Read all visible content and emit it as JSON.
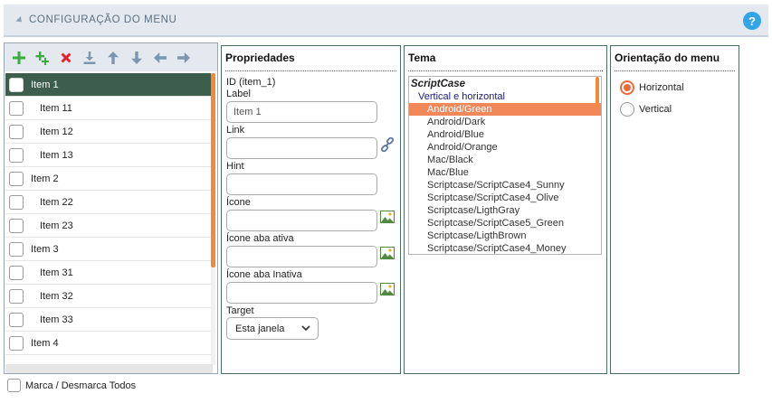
{
  "header": {
    "title": "CONFIGURAÇÃO DO MENU",
    "help_glyph": "?"
  },
  "toolbar": {
    "icons": [
      "add-icon",
      "add-child-icon",
      "delete-icon",
      "download-icon",
      "arrow-up-icon",
      "arrow-down-icon",
      "arrow-left-icon",
      "arrow-right-icon"
    ],
    "colors": {
      "add": "#3dab3d",
      "delete": "#e3232f",
      "move": "#7d96b0"
    }
  },
  "items": [
    {
      "label": "Item 1",
      "level": 0,
      "selected": true
    },
    {
      "label": "Item 11",
      "level": 1
    },
    {
      "label": "Item 12",
      "level": 1
    },
    {
      "label": "Item 13",
      "level": 1
    },
    {
      "label": "Item 2",
      "level": 0
    },
    {
      "label": "Item 22",
      "level": 1
    },
    {
      "label": "Item 23",
      "level": 1
    },
    {
      "label": "Item 3",
      "level": 0
    },
    {
      "label": "Item 31",
      "level": 1
    },
    {
      "label": "Item 32",
      "level": 1
    },
    {
      "label": "Item 33",
      "level": 1
    },
    {
      "label": "Item 4",
      "level": 0
    }
  ],
  "properties": {
    "title": "Propriedades",
    "id_text": "ID (item_1)",
    "label_caption": "Label",
    "label_value": "Item 1",
    "link_caption": "Link",
    "link_value": "",
    "hint_caption": "Hint",
    "hint_value": "",
    "icone_caption": "Ícone",
    "icone_value": "",
    "icone_ativa_caption": "Ícone aba ativa",
    "icone_ativa_value": "",
    "icone_inativa_caption": "Ícone aba Inativa",
    "icone_inativa_value": "",
    "target_caption": "Target",
    "target_value": "Esta janela"
  },
  "theme": {
    "title": "Tema",
    "group": "ScriptCase",
    "subgroup": "Vertical e horizontal",
    "options": [
      "Android/Green",
      "Android/Dark",
      "Android/Blue",
      "Android/Orange",
      "Mac/Black",
      "Mac/Blue",
      "Scriptcase/ScriptCase4_Sunny",
      "Scriptcase/ScriptCase4_Olive",
      "Scriptcase/LigthGray",
      "Scriptcase/ScriptCase5_Green",
      "Scriptcase/LigthBrown",
      "Scriptcase/ScriptCase4_Money"
    ],
    "selected": "Android/Green"
  },
  "orientation": {
    "title": "Orientação do menu",
    "options": [
      "Horizontal",
      "Vertical"
    ],
    "selected": "Horizontal"
  },
  "bottom": {
    "toggle_all_label": "Marca / Desmarca Todos"
  },
  "colors": {
    "accent": "#f28a3a",
    "selected_row": "#3d5e4c",
    "help": "#33a4e6"
  }
}
